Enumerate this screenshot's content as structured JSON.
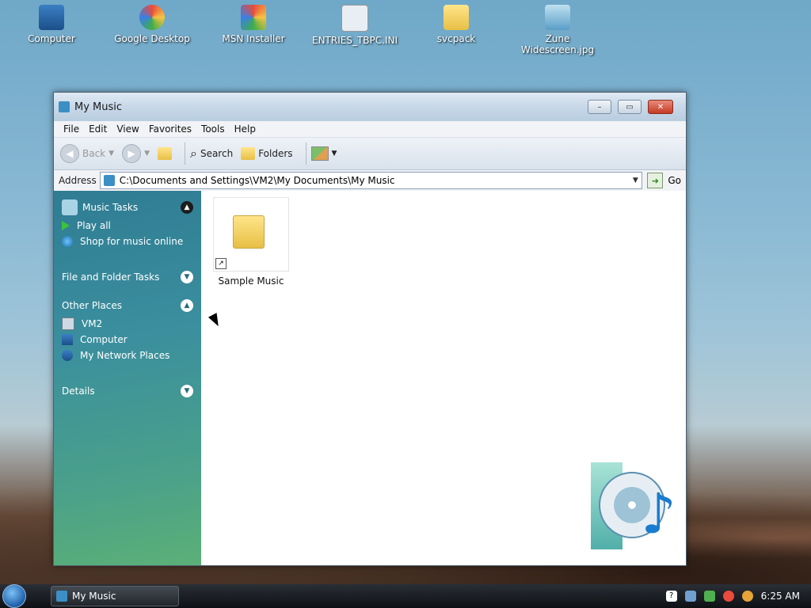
{
  "desktop": {
    "icons": [
      {
        "label": "Computer"
      },
      {
        "label": "Google Desktop"
      },
      {
        "label": "MSN Installer"
      },
      {
        "label": "ENTRIES_TBPC.INI"
      },
      {
        "label": "svcpack"
      },
      {
        "label": "Zune Widescreen.jpg"
      }
    ]
  },
  "window": {
    "title": "My Music",
    "buttons": {
      "minimize": "–",
      "maximize": "▭",
      "close": "✕"
    }
  },
  "menu": [
    "File",
    "Edit",
    "View",
    "Favorites",
    "Tools",
    "Help"
  ],
  "toolbar": {
    "back": "Back",
    "search": "Search",
    "folders": "Folders"
  },
  "address": {
    "label": "Address",
    "path": "C:\\Documents and Settings\\VM2\\My Documents\\My Music",
    "go": "Go"
  },
  "sidebar": {
    "music_tasks": {
      "title": "Music Tasks",
      "items": [
        "Play all",
        "Shop for music online"
      ]
    },
    "file_folder_tasks": {
      "title": "File and Folder Tasks"
    },
    "other_places": {
      "title": "Other Places",
      "items": [
        "VM2",
        "Computer",
        "My Network Places"
      ]
    },
    "details": {
      "title": "Details"
    }
  },
  "content": {
    "items": [
      {
        "name": "Sample Music"
      }
    ]
  },
  "taskbar": {
    "task": "My Music",
    "clock": "6:25 AM"
  }
}
